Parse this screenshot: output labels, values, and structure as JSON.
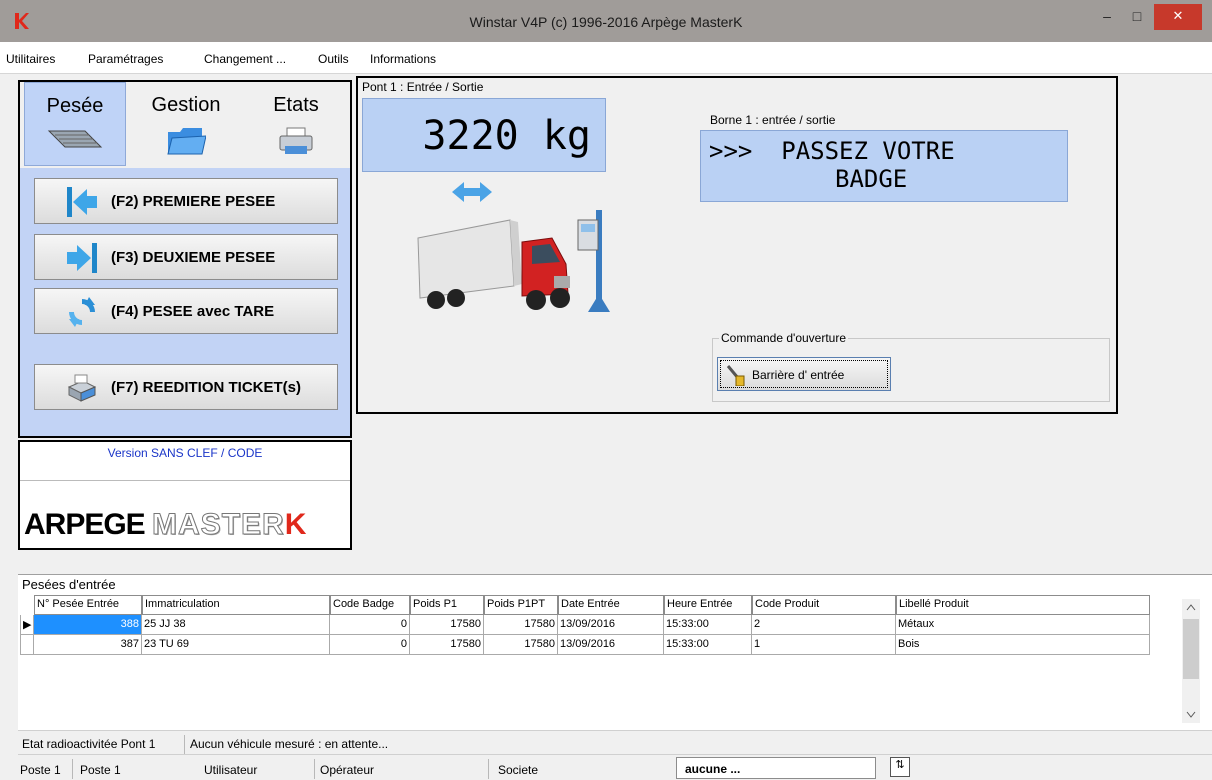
{
  "window": {
    "title": "Winstar V4P (c) 1996-2016 Arpège MasterK",
    "minimize": "–",
    "maximize": "□",
    "close": "✕"
  },
  "menu": [
    "Utilitaires",
    "Paramétrages",
    "Changement ...",
    "Outils",
    "Informations"
  ],
  "tabs": [
    {
      "label": "Pesée",
      "icon": "scale-icon"
    },
    {
      "label": "Gestion",
      "icon": "folder-icon"
    },
    {
      "label": "Etats",
      "icon": "printer-icon"
    }
  ],
  "actions": [
    {
      "label": "(F2) PREMIERE PESEE",
      "icon": "arrow-left-icon"
    },
    {
      "label": "(F3) DEUXIEME PESEE",
      "icon": "arrow-right-icon"
    },
    {
      "label": "(F4) PESEE avec TARE",
      "icon": "refresh-icon"
    },
    {
      "label": "(F7) REEDITION TICKET(s)",
      "icon": "printer-icon"
    }
  ],
  "info": {
    "version": "Version SANS CLEF / CODE",
    "brand_a": "ARPEGE ",
    "brand_b": "MASTER",
    "brand_c": "K"
  },
  "pont": {
    "label": "Pont 1 : Entrée / Sortie",
    "weight": "3220  kg",
    "borne_label": "Borne 1 : entrée / sortie",
    "borne_line1": ">>>  PASSEZ VOTRE",
    "borne_line2": "BADGE",
    "cmd_label": "Commande d'ouverture",
    "barrier_label": "Barrière d' entrée"
  },
  "grid": {
    "title": "Pesées d'entrée",
    "columns": [
      "N° Pesée Entrée",
      "Immatriculation",
      "Code Badge",
      "Poids P1",
      "Poids P1PT",
      "Date Entrée",
      "Heure Entrée",
      "Code Produit",
      "Libellé Produit"
    ],
    "rows": [
      {
        "num": "388",
        "immat": "25 JJ 38",
        "badge": "0",
        "p1": "17580",
        "p1pt": "17580",
        "date": "13/09/2016",
        "heure": "15:33:00",
        "code": "2",
        "libelle": "Métaux"
      },
      {
        "num": "387",
        "immat": "23 TU 69",
        "badge": "0",
        "p1": "17580",
        "p1pt": "17580",
        "date": "13/09/2016",
        "heure": "15:33:00",
        "code": "1",
        "libelle": "Bois"
      }
    ]
  },
  "status": {
    "radio": "Etat radioactivitée Pont 1",
    "message": "Aucun véhicule mesuré : en attente...",
    "poste_a": "Poste 1",
    "poste_b": "Poste 1",
    "utilisateur": "Utilisateur",
    "operateur": "Opérateur",
    "societe": "Societe",
    "societe_value": "aucune ...",
    "spin": "⇅"
  },
  "colors": {
    "accent": "#bad1f4",
    "selection": "#1e90ff",
    "close": "#c7392b",
    "brand_red": "#e0281b"
  }
}
